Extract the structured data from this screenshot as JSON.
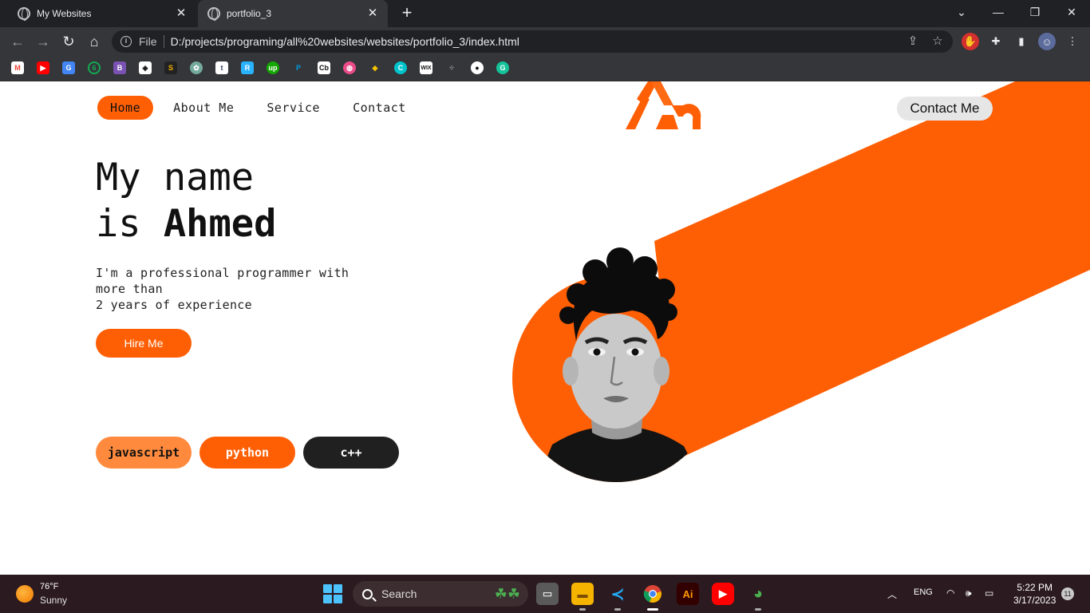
{
  "browser": {
    "tabs": [
      {
        "title": "My Websites",
        "active": false
      },
      {
        "title": "portfolio_3",
        "active": true
      }
    ],
    "new_tab_symbol": "+",
    "address": {
      "scheme_label": "File",
      "url": "D:/projects/programing/all%20websites/websites/portfolio_3/index.html"
    },
    "bookmarks": [
      "gmail-icon",
      "youtube-icon",
      "translate-icon",
      "mongodb-icon",
      "bootstrap-icon",
      "codepen-icon",
      "sololearn-icon",
      "chatgpt-icon",
      "tumblr-icon",
      "freelancer-icon",
      "upwork-icon",
      "paypal-icon",
      "crunchbase-icon",
      "dribbble-icon",
      "bookmark-icon",
      "canva-icon",
      "wix-icon",
      "dots-icon",
      "github-icon",
      "grammarly-icon"
    ]
  },
  "site": {
    "nav": {
      "items": [
        "Home",
        "About Me",
        "Service",
        "Contact"
      ],
      "active": "Home"
    },
    "contact_button": "Contact Me",
    "hero": {
      "line1": "My name",
      "line2_prefix": "is",
      "name": "Ahmed",
      "description_lines": [
        "I'm a professional programmer with",
        "more than",
        "2 years of experience"
      ],
      "hire_button": "Hire Me"
    },
    "skills": [
      "javascript",
      "python",
      "c++"
    ],
    "accent_color": "#ff5f04"
  },
  "taskbar": {
    "weather": {
      "temp": "76°F",
      "condition": "Sunny"
    },
    "search_label": "Search",
    "tray": {
      "language": "ENG",
      "time": "5:22 PM",
      "date": "3/17/2023",
      "notifications": "11"
    }
  }
}
